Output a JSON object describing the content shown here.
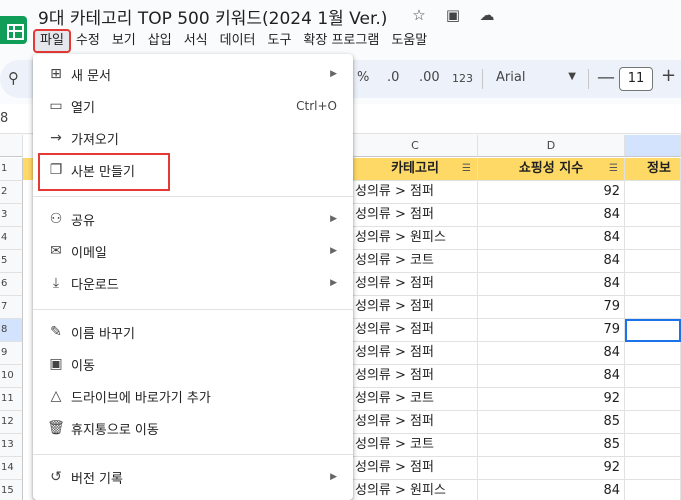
{
  "title": {
    "doc_title": "9대 카테고리 TOP 500 키워드(2024 1월 Ver.)",
    "icons": [
      "star-icon",
      "move-folder-icon",
      "cloud-status-icon"
    ]
  },
  "menubar": {
    "items": [
      "파일",
      "수정",
      "보기",
      "삽입",
      "서식",
      "데이터",
      "도구",
      "확장 프로그램",
      "도움말"
    ],
    "active": "파일"
  },
  "toolbar": {
    "percent": "%",
    "dec_decrease": ".0",
    "dec_increase": ".00",
    "format_123": "123",
    "font": "Arial",
    "size_minus": "—",
    "size": "11",
    "size_plus": "+"
  },
  "formula_bar": {
    "name_box": "8"
  },
  "grid": {
    "columns": [
      "C",
      "D"
    ],
    "header_row": {
      "category": "카테고리",
      "shopping_index": "쇼핑성 지수",
      "info": "정보"
    },
    "row_numbers": [
      "1",
      "2",
      "3",
      "4",
      "5",
      "6",
      "7",
      "8",
      "9",
      "10",
      "11",
      "12",
      "13",
      "14",
      "15"
    ],
    "rows": [
      {
        "category": "성의류 > 점퍼",
        "index": "92"
      },
      {
        "category": "성의류 > 점퍼",
        "index": "84"
      },
      {
        "category": "성의류 > 원피스",
        "index": "84"
      },
      {
        "category": "성의류 > 코트",
        "index": "84"
      },
      {
        "category": "성의류 > 점퍼",
        "index": "84"
      },
      {
        "category": "성의류 > 점퍼",
        "index": "79"
      },
      {
        "category": "성의류 > 점퍼",
        "index": "79"
      },
      {
        "category": "성의류 > 점퍼",
        "index": "84"
      },
      {
        "category": "성의류 > 점퍼",
        "index": "84"
      },
      {
        "category": "성의류 > 코트",
        "index": "92"
      },
      {
        "category": "성의류 > 점퍼",
        "index": "85"
      },
      {
        "category": "성의류 > 코트",
        "index": "85"
      },
      {
        "category": "성의류 > 점퍼",
        "index": "92"
      },
      {
        "category": "성의류 > 원피스",
        "index": "84"
      }
    ]
  },
  "file_menu": {
    "new": "새 문서",
    "open": "열기",
    "open_shortcut": "Ctrl+O",
    "import": "가져오기",
    "make_copy": "사본 만들기",
    "share": "공유",
    "email": "이메일",
    "download": "다운로드",
    "rename": "이름 바꾸기",
    "move": "이동",
    "add_shortcut": "드라이브에 바로가기 추가",
    "trash": "휴지통으로 이동",
    "version_history": "버전 기록"
  },
  "colors": {
    "header_fill": "#ffd966",
    "highlight": "#e53935",
    "selection": "#1a73e8",
    "logo": "#0f9d58"
  }
}
